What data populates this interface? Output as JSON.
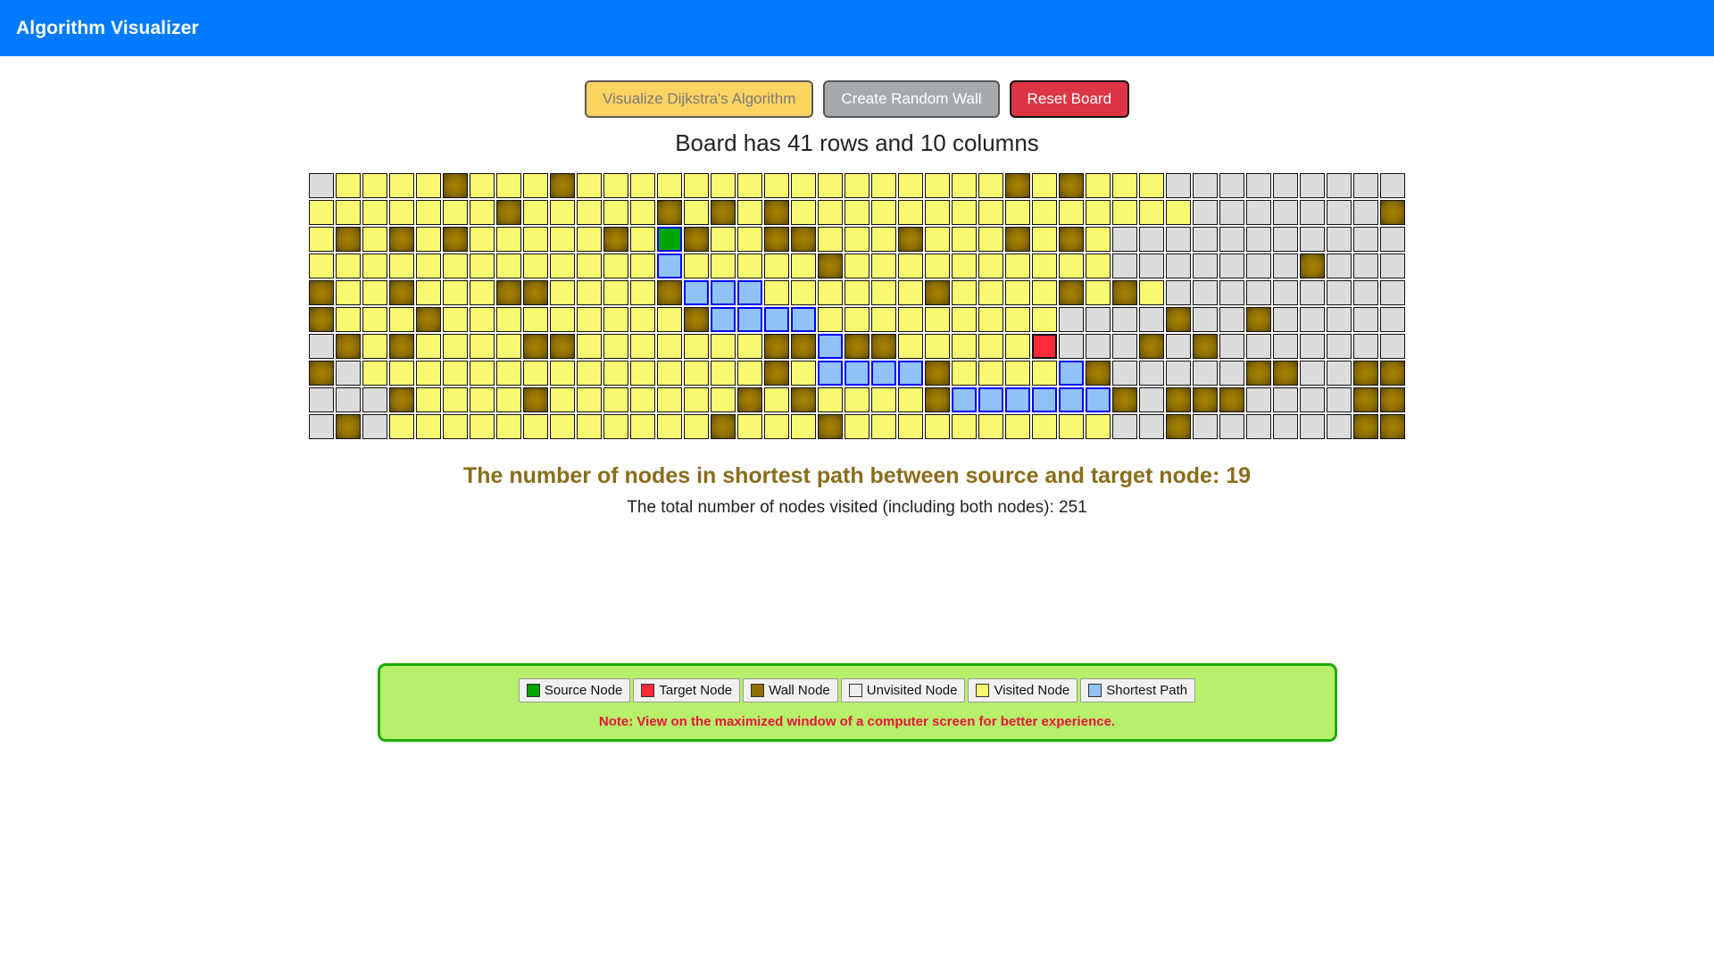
{
  "header": {
    "title": "Algorithm Visualizer",
    "background_color": "#007bff"
  },
  "toolbar": {
    "visualize_label": "Visualize Dijkstra's Algorithm",
    "random_wall_label": "Create Random Wall",
    "reset_board_label": "Reset Board"
  },
  "board": {
    "heading": "Board has 41 rows and 10 columns",
    "rows": 10,
    "cols": 41,
    "cell_size_px": 30,
    "legend_colors": {
      "source": "#00a500",
      "target": "#ff2b39",
      "wall": "#8f6f02",
      "unvisited": "#dcdcdc",
      "visited": "#f9f871",
      "path": "#90c2f8"
    },
    "cells": [
      [
        "U",
        "V",
        "V",
        "V",
        "V",
        "W",
        "V",
        "V",
        "V",
        "W",
        "V",
        "V",
        "V",
        "V",
        "V",
        "V",
        "V",
        "V",
        "V",
        "V",
        "V",
        "V",
        "V",
        "V",
        "V",
        "V",
        "W",
        "V",
        "W",
        "V",
        "V",
        "V",
        "U",
        "U",
        "U",
        "U",
        "U",
        "U",
        "U",
        "U",
        "U"
      ],
      [
        "V",
        "V",
        "V",
        "V",
        "V",
        "V",
        "V",
        "W",
        "V",
        "V",
        "V",
        "V",
        "V",
        "W",
        "V",
        "W",
        "V",
        "W",
        "V",
        "V",
        "V",
        "V",
        "V",
        "V",
        "V",
        "V",
        "V",
        "V",
        "V",
        "V",
        "V",
        "V",
        "V",
        "U",
        "U",
        "U",
        "U",
        "U",
        "U",
        "U",
        "W"
      ],
      [
        "V",
        "W",
        "V",
        "W",
        "V",
        "W",
        "V",
        "V",
        "V",
        "V",
        "V",
        "W",
        "V",
        "S",
        "W",
        "V",
        "V",
        "W",
        "W",
        "V",
        "V",
        "V",
        "W",
        "V",
        "V",
        "V",
        "W",
        "V",
        "W",
        "V",
        "U",
        "U",
        "U",
        "U",
        "U",
        "U",
        "U",
        "U",
        "U",
        "U",
        "U"
      ],
      [
        "V",
        "V",
        "V",
        "V",
        "V",
        "V",
        "V",
        "V",
        "V",
        "V",
        "V",
        "V",
        "V",
        "P",
        "V",
        "V",
        "V",
        "V",
        "V",
        "W",
        "V",
        "V",
        "V",
        "V",
        "V",
        "V",
        "V",
        "V",
        "V",
        "V",
        "U",
        "U",
        "U",
        "U",
        "U",
        "U",
        "U",
        "W",
        "U",
        "U",
        "U"
      ],
      [
        "W",
        "V",
        "V",
        "W",
        "V",
        "V",
        "V",
        "W",
        "W",
        "V",
        "V",
        "V",
        "V",
        "W",
        "P",
        "P",
        "P",
        "V",
        "V",
        "V",
        "V",
        "V",
        "V",
        "W",
        "V",
        "V",
        "V",
        "V",
        "W",
        "V",
        "W",
        "V",
        "U",
        "U",
        "U",
        "U",
        "U",
        "U",
        "U",
        "U",
        "U"
      ],
      [
        "W",
        "V",
        "V",
        "V",
        "W",
        "V",
        "V",
        "V",
        "V",
        "V",
        "V",
        "V",
        "V",
        "V",
        "W",
        "P",
        "P",
        "P",
        "P",
        "V",
        "V",
        "V",
        "V",
        "V",
        "V",
        "V",
        "V",
        "V",
        "U",
        "U",
        "U",
        "U",
        "W",
        "U",
        "U",
        "W",
        "U",
        "U",
        "U",
        "U",
        "U"
      ],
      [
        "U",
        "W",
        "V",
        "W",
        "V",
        "V",
        "V",
        "V",
        "W",
        "W",
        "V",
        "V",
        "V",
        "V",
        "V",
        "V",
        "V",
        "W",
        "W",
        "P",
        "W",
        "W",
        "V",
        "V",
        "V",
        "V",
        "V",
        "T",
        "U",
        "U",
        "U",
        "W",
        "U",
        "W",
        "U",
        "U",
        "U",
        "U",
        "U",
        "U",
        "U"
      ],
      [
        "W",
        "U",
        "V",
        "V",
        "V",
        "V",
        "V",
        "V",
        "V",
        "V",
        "V",
        "V",
        "V",
        "V",
        "V",
        "V",
        "V",
        "W",
        "V",
        "P",
        "P",
        "P",
        "P",
        "W",
        "V",
        "V",
        "V",
        "V",
        "P",
        "W",
        "U",
        "U",
        "U",
        "U",
        "U",
        "W",
        "W",
        "U",
        "U",
        "W",
        "W"
      ],
      [
        "U",
        "U",
        "U",
        "W",
        "V",
        "V",
        "V",
        "V",
        "W",
        "V",
        "V",
        "V",
        "V",
        "V",
        "V",
        "V",
        "W",
        "V",
        "W",
        "V",
        "V",
        "V",
        "V",
        "W",
        "P",
        "P",
        "P",
        "P",
        "P",
        "P",
        "W",
        "U",
        "W",
        "W",
        "W",
        "U",
        "U",
        "U",
        "U",
        "W",
        "W"
      ],
      [
        "U",
        "W",
        "U",
        "V",
        "V",
        "V",
        "V",
        "V",
        "V",
        "V",
        "V",
        "V",
        "V",
        "V",
        "V",
        "W",
        "V",
        "V",
        "V",
        "W",
        "V",
        "V",
        "V",
        "V",
        "V",
        "V",
        "V",
        "V",
        "V",
        "V",
        "U",
        "U",
        "W",
        "U",
        "U",
        "U",
        "U",
        "U",
        "U",
        "W",
        "W"
      ]
    ]
  },
  "results": {
    "primary": "The number of nodes in shortest path between source and target node: 19",
    "secondary": "The total number of nodes visited (including both nodes): 251",
    "shortest_path_nodes": 19,
    "total_visited_nodes": 251
  },
  "legend": {
    "items": [
      {
        "label": "Source Node",
        "color": "#00a500"
      },
      {
        "label": "Target Node",
        "color": "#ff2b39"
      },
      {
        "label": "Wall Node",
        "color": "#8f6f02"
      },
      {
        "label": "Unvisited Node",
        "color": "#eeeeee"
      },
      {
        "label": "Visited Node",
        "color": "#f9f871"
      },
      {
        "label": "Shortest Path",
        "color": "#90c2f8"
      }
    ],
    "note": "Note: View on the maximized window of a computer screen for better experience.",
    "note_color": "#e5143c",
    "background_color": "#b7f06a",
    "border_color": "#1faa00"
  }
}
